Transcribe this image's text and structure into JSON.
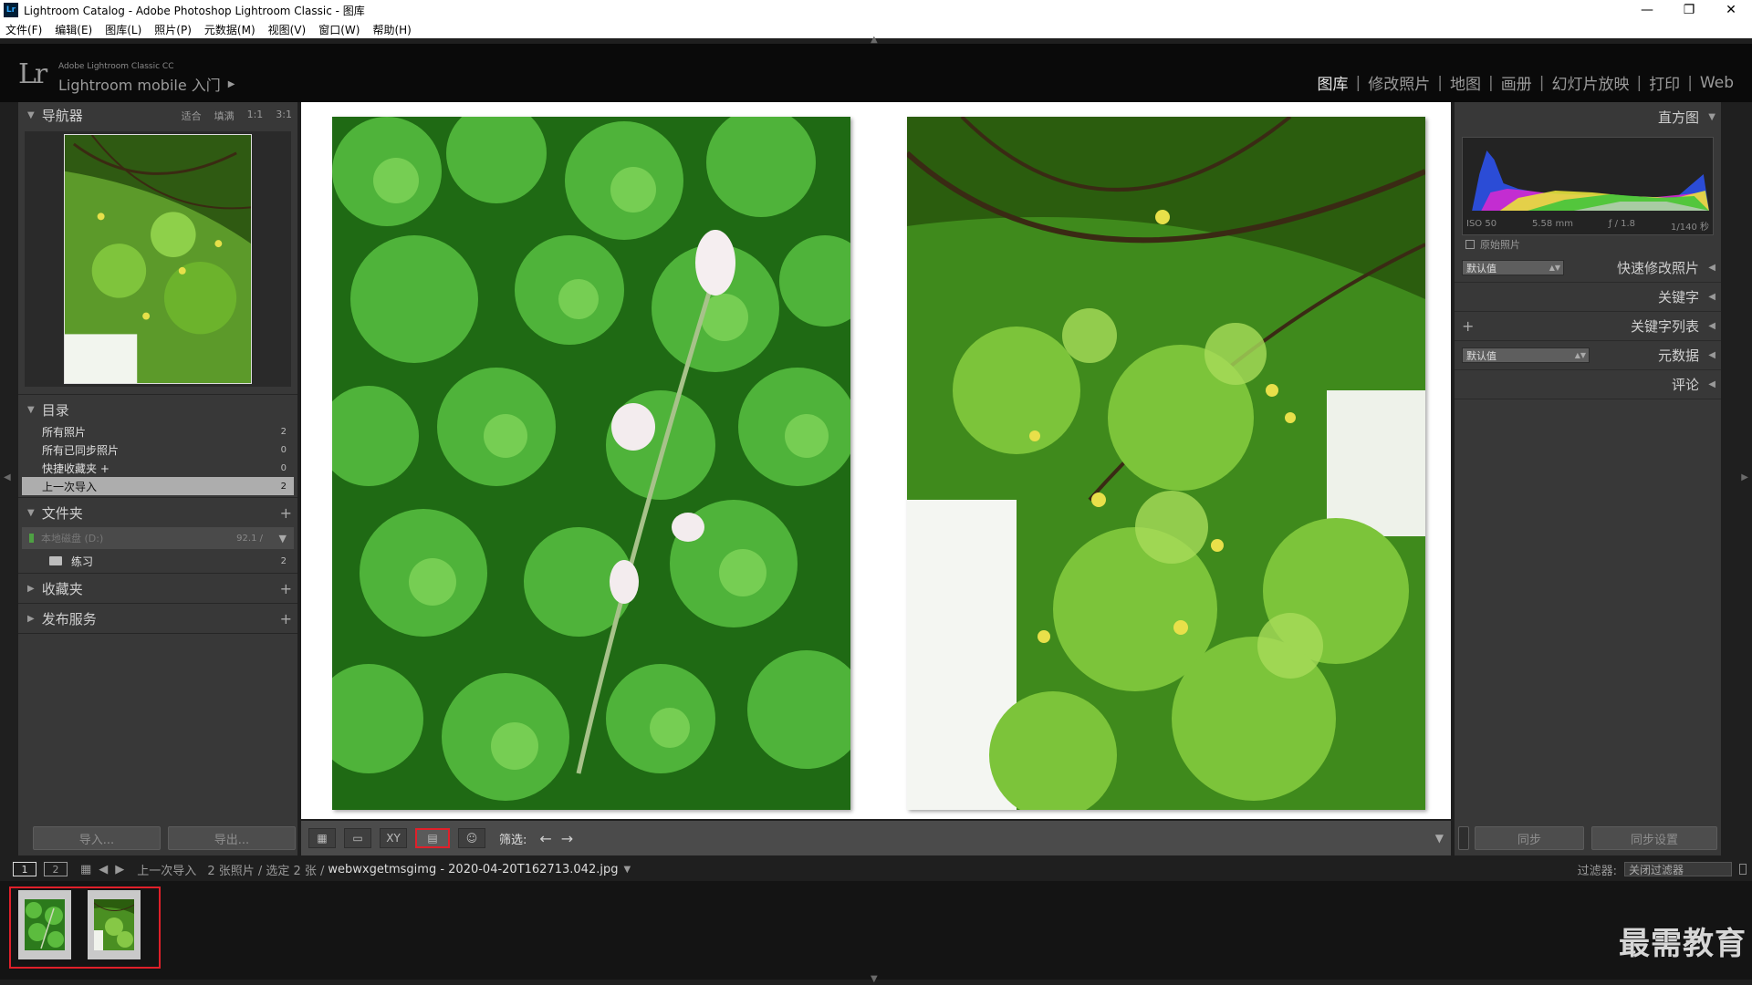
{
  "window": {
    "badge": "Lr",
    "title": "Lightroom Catalog - Adobe Photoshop Lightroom Classic - 图库",
    "minimize": "—",
    "restore": "❐",
    "close": "✕"
  },
  "menu": [
    "文件(F)",
    "编辑(E)",
    "图库(L)",
    "照片(P)",
    "元数据(M)",
    "视图(V)",
    "窗口(W)",
    "帮助(H)"
  ],
  "identity": {
    "logo": "Lr",
    "product": "Adobe Lightroom Classic CC",
    "mobile_label": "Lightroom mobile 入门",
    "mobile_arrow": "▶"
  },
  "modules": [
    "图库",
    "修改照片",
    "地图",
    "画册",
    "幻灯片放映",
    "打印",
    "Web"
  ],
  "active_module": "图库",
  "navigator": {
    "title": "导航器",
    "options": [
      "适合",
      "填满",
      "1:1",
      "3:1"
    ]
  },
  "catalog": {
    "title": "目录",
    "items": [
      {
        "label": "所有照片",
        "count": "2"
      },
      {
        "label": "所有已同步照片",
        "count": "0"
      },
      {
        "label": "快捷收藏夹 +",
        "count": "0"
      },
      {
        "label": "上一次导入",
        "count": "2"
      }
    ]
  },
  "folders": {
    "title": "文件夹",
    "volume_name": "本地磁盘 (D:)",
    "volume_size": "92.1 /",
    "folder": {
      "label": "练习",
      "count": "2"
    }
  },
  "collections": {
    "title": "收藏夹"
  },
  "publish": {
    "title": "发布服务"
  },
  "left_buttons": {
    "import": "导入...",
    "export": "导出..."
  },
  "toolbar": {
    "filter_label": "筛选:",
    "view_modes": [
      "grid-view",
      "loupe-view",
      "compare-view",
      "survey-view",
      "people-view"
    ],
    "active_view": "survey-view",
    "compare_text": "XY"
  },
  "right_panel": {
    "histogram": {
      "title": "直方图",
      "iso": "ISO 50",
      "focal": "5.58 mm",
      "aperture": "ƒ / 1.8",
      "shutter": "1/140 秒",
      "original_label": "原始照片"
    },
    "quick_develop": {
      "title": "快速修改照片",
      "preset": "默认值"
    },
    "keywording": {
      "title": "关键字"
    },
    "keyword_list": {
      "title": "关键字列表"
    },
    "metadata": {
      "title": "元数据",
      "preset": "默认值"
    },
    "comments": {
      "title": "评论"
    },
    "sync_button": "同步",
    "sync_settings_button": "同步设置"
  },
  "filmstrip": {
    "pages": [
      "1",
      "2"
    ],
    "source": "上一次导入",
    "summary": "2 张照片 / 选定 2 张 /",
    "filename": "webwxgetmsgimg - 2020-04-20T162713.042.jpg",
    "filter_label": "过滤器:",
    "filter_value": "关闭过滤器",
    "thumbnails": [
      "clover",
      "tree"
    ]
  },
  "watermark": "最需教育",
  "colors": {
    "accent_red": "#e0202a",
    "panel_bg": "#383838",
    "app_bg": "#1f1f1f"
  }
}
